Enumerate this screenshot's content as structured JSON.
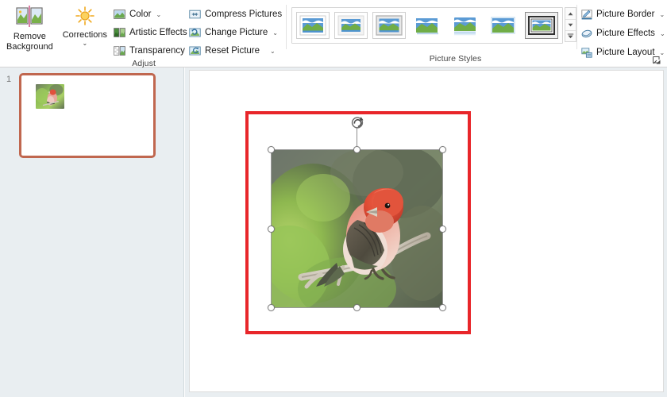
{
  "ribbon": {
    "groups": [
      {
        "name": "Adjust",
        "label": "Adjust",
        "big_buttons": [
          {
            "id": "remove-background",
            "label_line1": "Remove",
            "label_line2": "Background",
            "icon": "remove-background-icon",
            "has_chevron": false
          },
          {
            "id": "corrections",
            "label_line1": "Corrections",
            "label_line2": "",
            "icon": "corrections-sun-icon",
            "has_chevron": true,
            "chevron": "⌄"
          }
        ],
        "small_buttons_col1": [
          {
            "id": "color",
            "label": "Color",
            "icon": "color-picture-icon",
            "chevron": "⌄"
          },
          {
            "id": "artistic-effects",
            "label": "Artistic Effects",
            "icon": "artistic-effects-icon",
            "chevron": "⌄"
          },
          {
            "id": "transparency",
            "label": "Transparency",
            "icon": "transparency-icon",
            "chevron": "⌄"
          }
        ],
        "small_buttons_col2": [
          {
            "id": "compress-pictures",
            "label": "Compress Pictures",
            "icon": "compress-pictures-icon",
            "chevron": ""
          },
          {
            "id": "change-picture",
            "label": "Change Picture",
            "icon": "change-picture-icon",
            "chevron": "⌄"
          },
          {
            "id": "reset-picture",
            "label": "Reset Picture",
            "icon": "reset-picture-icon",
            "chevron": "⌄"
          }
        ]
      },
      {
        "name": "Picture Styles",
        "label": "Picture Styles",
        "gallery": {
          "items": [
            {
              "id": "style-1",
              "name": "simple-frame-white",
              "framed": true,
              "selected": false,
              "shadow": false
            },
            {
              "id": "style-2",
              "name": "beveled-matte-white",
              "framed": true,
              "selected": false,
              "shadow": false
            },
            {
              "id": "style-3",
              "name": "metal-frame",
              "framed": true,
              "selected": false,
              "shadow": false
            },
            {
              "id": "style-4",
              "name": "drop-shadow-rectangle",
              "framed": false,
              "selected": false,
              "shadow": true
            },
            {
              "id": "style-5",
              "name": "reflected-rounded-rectangle",
              "framed": false,
              "selected": false,
              "shadow": true
            },
            {
              "id": "style-6",
              "name": "soft-edge-rectangle",
              "framed": false,
              "selected": false,
              "shadow": true
            },
            {
              "id": "style-7",
              "name": "double-frame-black",
              "framed": true,
              "selected": true,
              "shadow": false
            }
          ],
          "scroll_buttons": [
            {
              "id": "gallery-scroll-up",
              "glyph": "▲",
              "name": "scroll-up-icon"
            },
            {
              "id": "gallery-scroll-down",
              "glyph": "▼",
              "name": "scroll-down-icon"
            },
            {
              "id": "gallery-more",
              "glyph": "▾",
              "name": "gallery-more-icon"
            }
          ]
        },
        "side_buttons": [
          {
            "id": "picture-border",
            "label": "Picture Border",
            "icon": "picture-border-icon",
            "chevron": "⌄"
          },
          {
            "id": "picture-effects",
            "label": "Picture Effects",
            "icon": "picture-effects-icon",
            "chevron": "⌄"
          },
          {
            "id": "picture-layout",
            "label": "Picture Layout",
            "icon": "picture-layout-icon",
            "chevron": "⌄"
          }
        ],
        "dialog_launcher": {
          "id": "picture-styles-dialog-launcher",
          "name": "dialog-launcher-icon"
        }
      }
    ]
  },
  "thumbnail_pane": {
    "slides": [
      {
        "number": "1",
        "selected": true,
        "name": "slide-thumbnail-1",
        "content": "bird-photo"
      }
    ]
  },
  "canvas": {
    "slide": {
      "name": "slide-canvas",
      "picture": {
        "name": "bird-picture",
        "alt": "House finch perched on a branch",
        "selected": true,
        "handles": [
          "nw",
          "n",
          "ne",
          "w",
          "e",
          "sw",
          "s",
          "se"
        ],
        "rotate_handle": {
          "name": "rotate-handle-icon"
        }
      }
    },
    "annotation": {
      "name": "red-highlight-rectangle",
      "color": "#e8262a"
    }
  },
  "colors": {
    "accent_red": "#e8262a",
    "thumb_border": "#c0674f",
    "pane_bg": "#e9eef1",
    "ribbon_bg": "#ffffff"
  }
}
